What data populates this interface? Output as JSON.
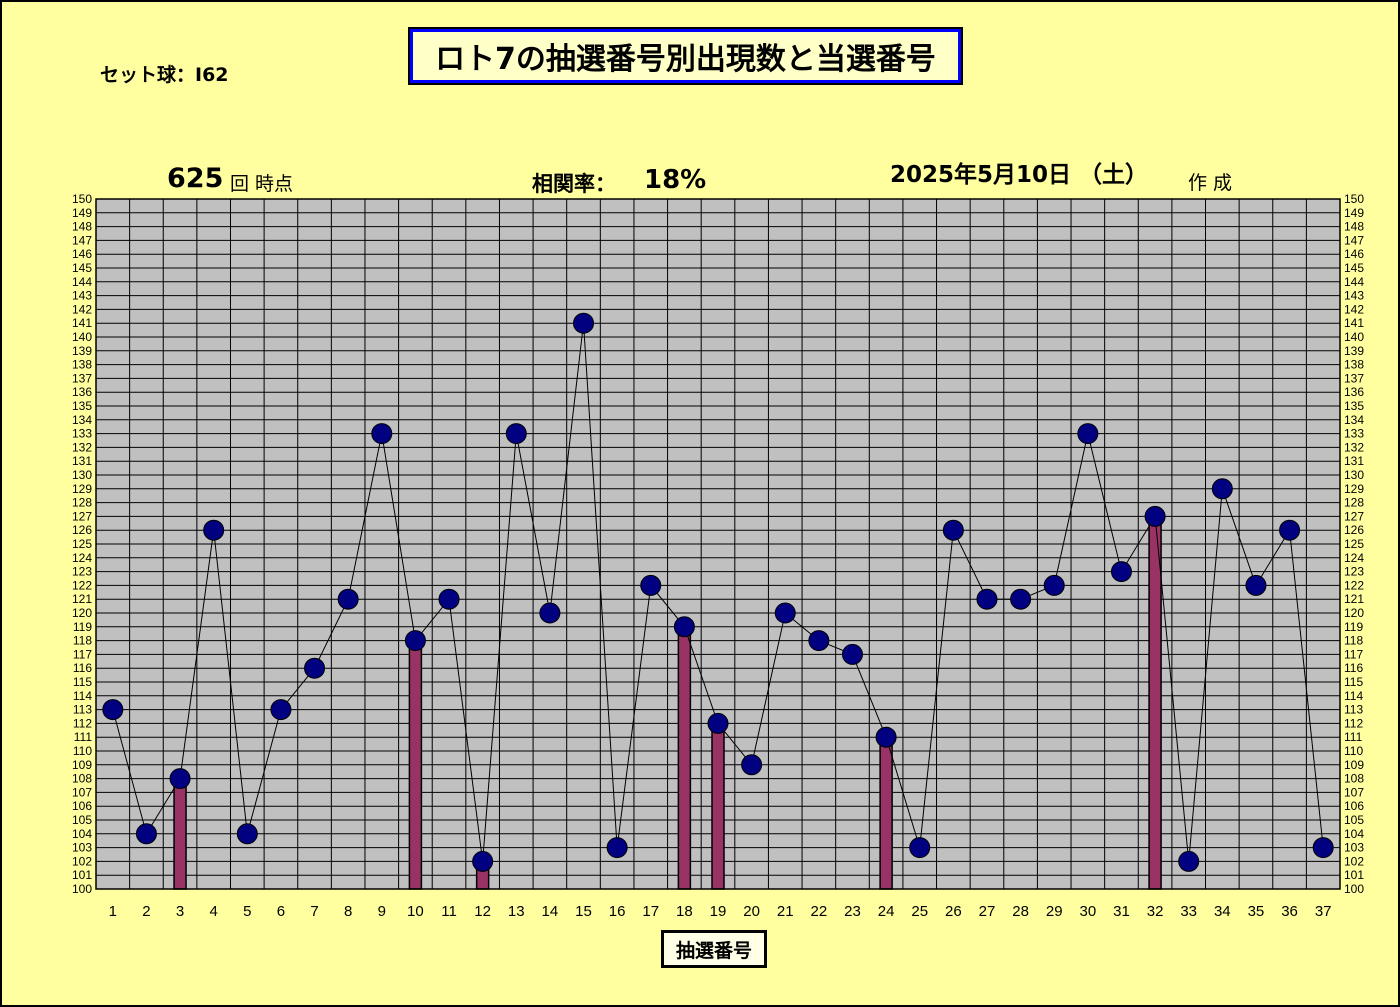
{
  "title": "ロト7の抽選番号別出現数と当選番号",
  "set_ball": "セット球：I62",
  "draw_count": "625",
  "draw_count_label": "回 時点",
  "correlation_label": "相関率：",
  "correlation_value": "18%",
  "date": "2025年5月10日 （土）",
  "made_label": "作 成",
  "colors": {
    "plot_bg": "#c0c0c0",
    "marker": "#000080",
    "bar": "#993366",
    "line": "#000000"
  },
  "chart_data": {
    "type": "line",
    "xlabel": "抽選番号",
    "ylabel": "",
    "ylim": [
      100,
      150
    ],
    "categories": [
      "1",
      "2",
      "3",
      "4",
      "5",
      "6",
      "7",
      "8",
      "9",
      "10",
      "11",
      "12",
      "13",
      "14",
      "15",
      "16",
      "17",
      "18",
      "19",
      "20",
      "21",
      "22",
      "23",
      "24",
      "25",
      "26",
      "27",
      "28",
      "29",
      "30",
      "31",
      "32",
      "33",
      "34",
      "35",
      "36",
      "37"
    ],
    "series": [
      {
        "values": [
          113,
          104,
          108,
          126,
          104,
          113,
          116,
          121,
          133,
          118,
          121,
          102,
          133,
          120,
          141,
          103,
          122,
          119,
          112,
          109,
          120,
          118,
          117,
          111,
          103,
          126,
          121,
          121,
          122,
          133,
          123,
          127,
          102,
          129,
          122,
          126,
          103
        ]
      }
    ],
    "winning_numbers": [
      "3",
      "10",
      "12",
      "18",
      "19",
      "24",
      "32"
    ],
    "grid": true,
    "y_axis_both_sides": true
  }
}
